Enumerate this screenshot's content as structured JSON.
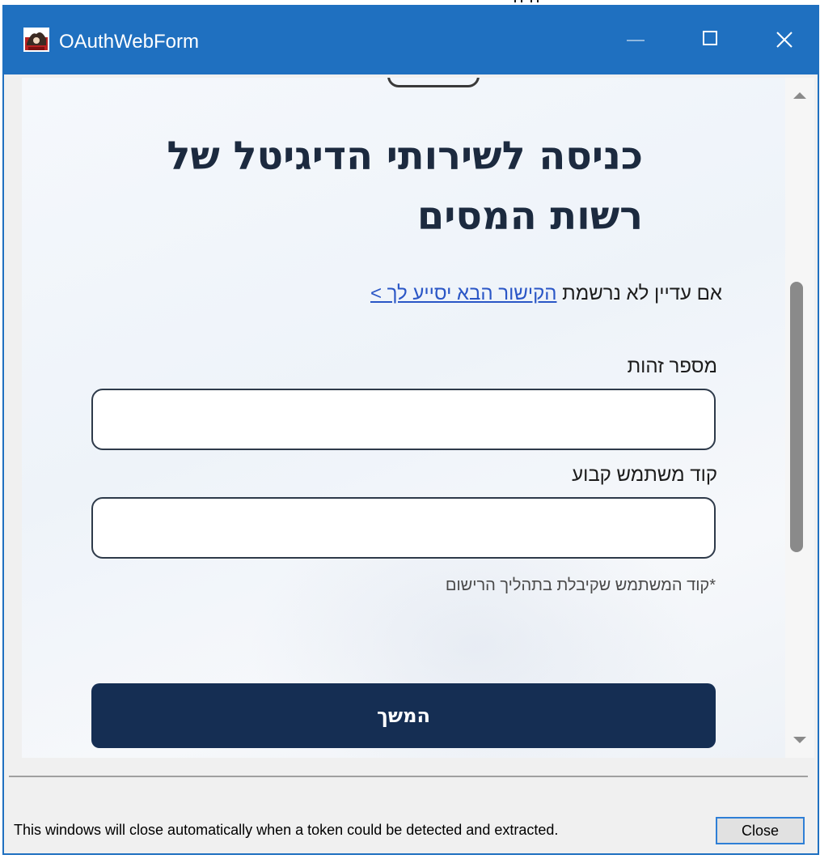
{
  "window": {
    "title": "OAuthWebForm",
    "accent_color": "#1f70c0",
    "icons": {
      "app": "app-icon",
      "minimize": "minimize-icon",
      "maximize": "maximize-icon",
      "close": "close-icon"
    }
  },
  "form": {
    "heading": "כניסה לשירותי הדיגיטל של רשות המסים",
    "register_prefix": "אם עדיין לא נרשמת",
    "register_link": "הקישור הבא יסייע לך >",
    "id_label": "מספר זהות",
    "id_value": "",
    "code_label": "קוד משתמש קבוע",
    "code_value": "",
    "code_hint": "*קוד המשתמש שקיבלת בתהליך הרישום",
    "continue_label": "המשך",
    "button_color": "#152e53",
    "link_color": "#2a56c6"
  },
  "footer": {
    "status": ".This windows will close automatically when a token could be detected and extracted",
    "close_label": "Close"
  }
}
